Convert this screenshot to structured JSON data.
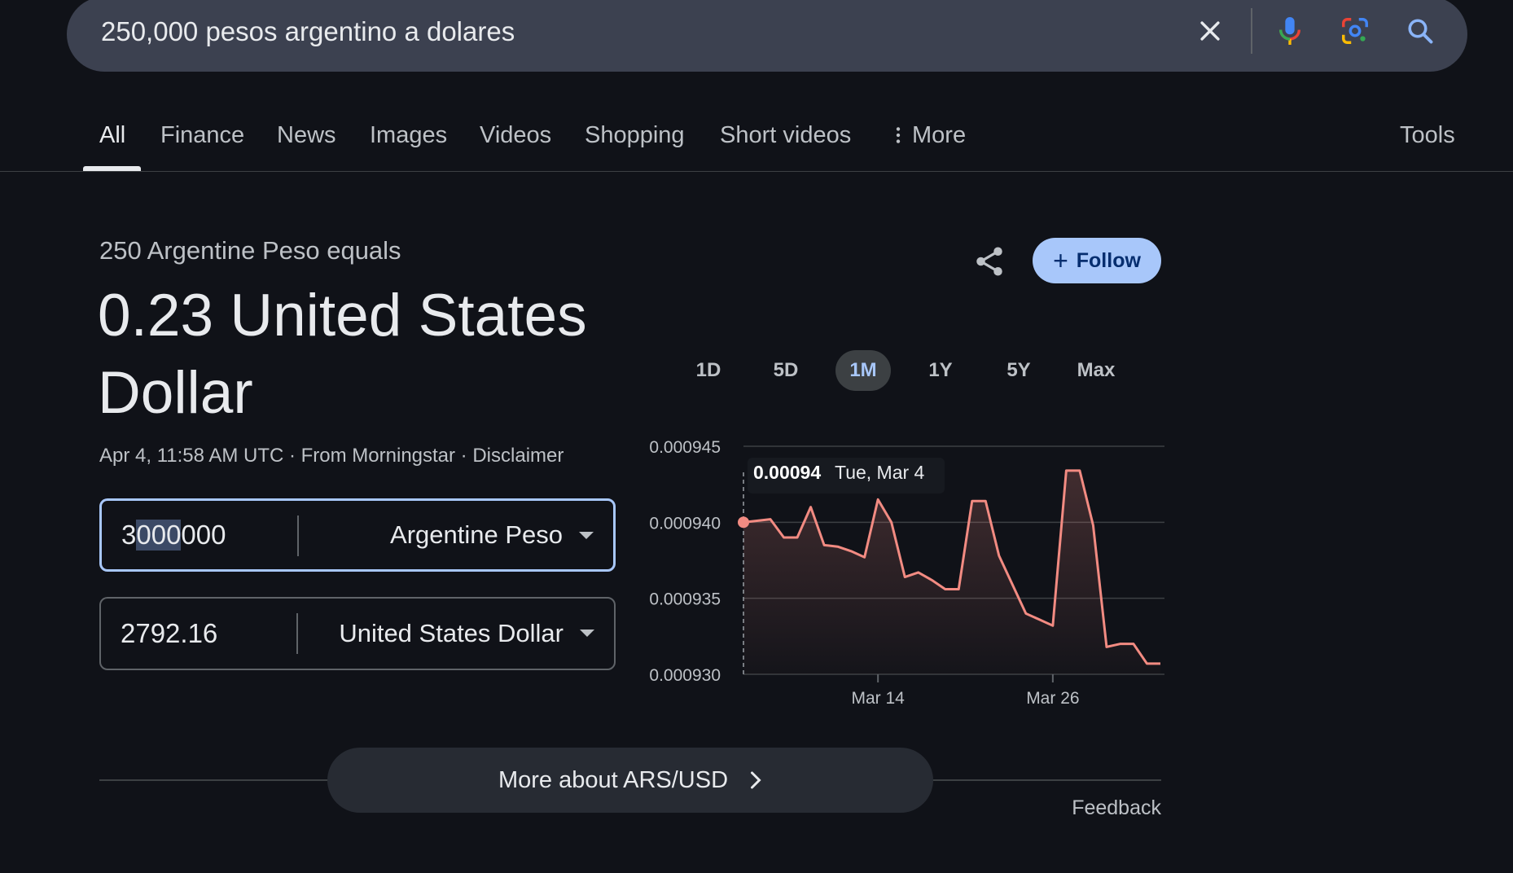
{
  "search": {
    "query": "250,000 pesos argentino a dolares",
    "icons": [
      "close-icon",
      "microphone-icon",
      "lens-camera-icon",
      "search-icon"
    ]
  },
  "tabs": {
    "items": [
      {
        "label": "All",
        "active": true
      },
      {
        "label": "Finance"
      },
      {
        "label": "News"
      },
      {
        "label": "Images"
      },
      {
        "label": "Videos"
      },
      {
        "label": "Shopping"
      },
      {
        "label": "Short videos"
      },
      {
        "label": "More"
      }
    ],
    "tools_label": "Tools"
  },
  "result": {
    "subhead": "250 Argentine Peso equals",
    "value": "0.23 United States Dollar",
    "meta": "Apr 4, 11:58 AM UTC · From Morningstar · Disclaimer",
    "follow_label": "Follow"
  },
  "converter": {
    "from": {
      "value_prefix": "3",
      "value_selected": "000",
      "value_suffix": "000",
      "currency": "Argentine Peso"
    },
    "to": {
      "value": "2792.16",
      "currency": "United States Dollar"
    }
  },
  "ranges": {
    "items": [
      "1D",
      "5D",
      "1M",
      "1Y",
      "5Y",
      "Max"
    ],
    "active": "1M"
  },
  "chart_data": {
    "type": "line",
    "ylim": [
      0.00093,
      0.000945
    ],
    "yticks": [
      "0.000945",
      "0.000940",
      "0.000935",
      "0.000930"
    ],
    "xticks": [
      {
        "label": "Mar 14",
        "index": 10
      },
      {
        "label": "Mar 26",
        "index": 23
      }
    ],
    "tooltip": {
      "value": "0.00094",
      "date": "Tue, Mar 4",
      "index": 0
    },
    "series": [
      {
        "color": "#f28b82",
        "values": [
          0.00094,
          0.0009401,
          0.0009402,
          0.000939,
          0.000939,
          0.000941,
          0.0009385,
          0.0009384,
          0.0009381,
          0.0009377,
          0.0009415,
          0.00094,
          0.0009364,
          0.0009367,
          0.0009362,
          0.0009356,
          0.0009356,
          0.0009414,
          0.0009414,
          0.0009378,
          0.0009359,
          0.000934,
          0.0009336,
          0.0009332,
          0.0009434,
          0.0009434,
          0.0009398,
          0.0009318,
          0.000932,
          0.000932,
          0.0009307,
          0.0009307
        ]
      }
    ]
  },
  "footer": {
    "more_label": "More about ARS/USD",
    "feedback_label": "Feedback"
  }
}
